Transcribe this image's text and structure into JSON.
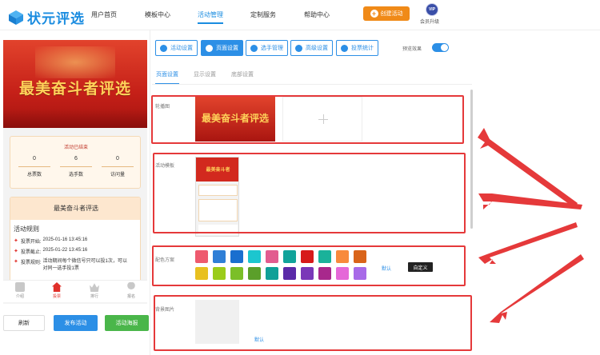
{
  "header": {
    "logo_text": "状元评选",
    "nav": [
      "用户首页",
      "模板中心",
      "活动管理",
      "定制服务",
      "帮助中心"
    ],
    "active_nav": "活动管理",
    "create_button": "创建活动",
    "vip_badge": "VIP",
    "vip_label": "会员升级"
  },
  "preview": {
    "banner_title": "最美奋斗者评选",
    "stats_title": "活动已结束",
    "stats": [
      {
        "value": "0",
        "label": "总票数"
      },
      {
        "value": "6",
        "label": "选手数"
      },
      {
        "value": "0",
        "label": "访问量"
      }
    ],
    "rule_card_title": "最美奋斗者评选",
    "rules_heading": "活动规则",
    "rules": [
      {
        "label": "投票开始:",
        "value": "2025-01-16 13:45:16"
      },
      {
        "label": "投票截止:",
        "value": "2025-01-22 13:45:16"
      },
      {
        "label": "投票规则:",
        "value": "活动期间每个微信号只可以投1次，可以对同一选手投1票"
      }
    ],
    "tabbar": [
      "介绍",
      "投票",
      "排行",
      "报名"
    ],
    "active_tab": "投票"
  },
  "actions": {
    "refresh": "刷新",
    "publish": "发布活动",
    "poster": "活动海报"
  },
  "settings_buttons": [
    "活动设置",
    "页面设置",
    "选手管理",
    "高级设置",
    "投票统计"
  ],
  "active_settings_button": "页面设置",
  "preview_effect_label": "预览效果",
  "preview_effect_on": true,
  "subtabs": [
    "页面设置",
    "显示设置",
    "底部设置"
  ],
  "active_subtab": "页面设置",
  "sections": {
    "carousel_label": "轮播图",
    "carousel_image_text": "最美奋斗者评选",
    "template_label": "活动模板",
    "template_thumb_text": "最美奋斗者",
    "color_label": "配色方案",
    "color_default": "默认",
    "color_custom": "自定义",
    "background_label": "背景图片",
    "background_default": "默认"
  },
  "colors": {
    "accent": "#2c8fe6",
    "annotation": "#e5393a",
    "swatches_row1": [
      "#ee5a6e",
      "#2f7fd6",
      "#1a6fcf",
      "#1cc6cf",
      "#e25c8f",
      "#11a39a",
      "#d71a1a",
      "#1ab29a",
      "#f88a3c",
      "#d9641a"
    ],
    "swatches_row2": [
      "#e8c020",
      "#9bcc1a",
      "#7bbf28",
      "#5b9f2a",
      "#0fa098",
      "#5a2aa8",
      "#7a38b8",
      "#a8288c",
      "#e568d8",
      "#a86ae8"
    ]
  }
}
